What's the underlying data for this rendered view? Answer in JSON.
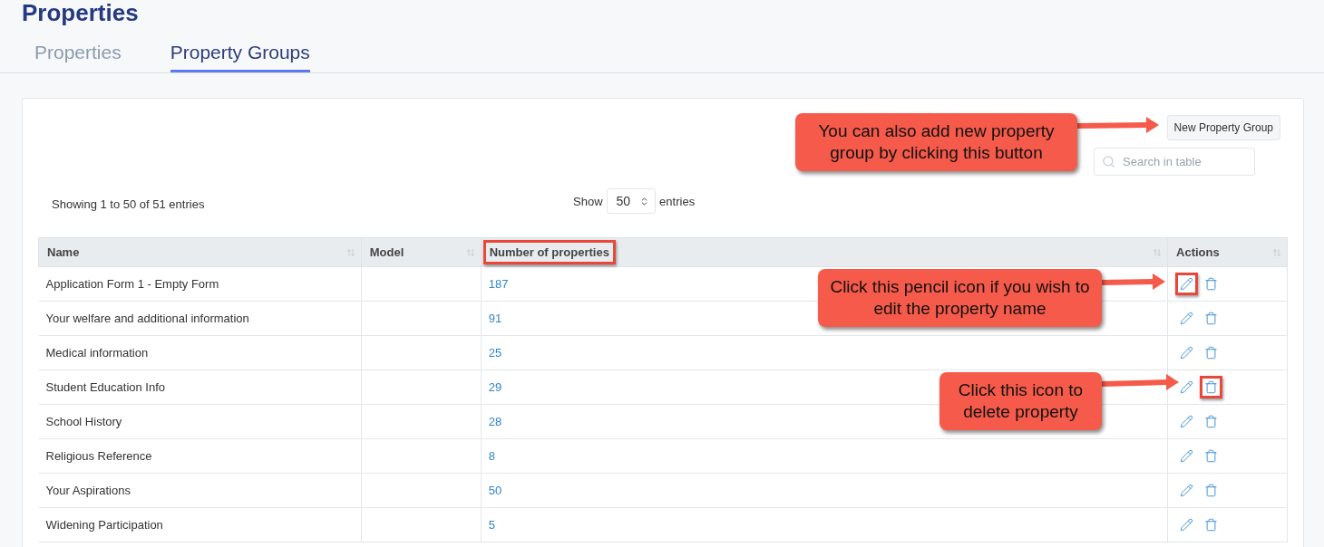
{
  "page_title": "Properties",
  "tabs": [
    {
      "label": "Properties",
      "selected": false
    },
    {
      "label": "Property Groups",
      "selected": true
    }
  ],
  "new_button": "New Property Group",
  "search": {
    "placeholder": "Search in table"
  },
  "info": "Showing 1 to 50 of 51 entries",
  "length": {
    "before": "Show",
    "value": "50",
    "after": "entries"
  },
  "columns": [
    {
      "label": "Name",
      "highlighted": false
    },
    {
      "label": "Model",
      "highlighted": false
    },
    {
      "label": "Number of properties",
      "highlighted": true
    },
    {
      "label": "Actions",
      "highlighted": false
    }
  ],
  "rows": [
    {
      "name": "Application Form 1 - Empty Form",
      "count": "187",
      "edit_highlighted": true,
      "delete_highlighted": false
    },
    {
      "name": "Your welfare and additional information",
      "count": "91",
      "edit_highlighted": false,
      "delete_highlighted": false
    },
    {
      "name": "Medical information",
      "count": "25",
      "edit_highlighted": false,
      "delete_highlighted": false
    },
    {
      "name": "Student Education Info",
      "count": "29",
      "edit_highlighted": false,
      "delete_highlighted": true
    },
    {
      "name": "School History",
      "count": "28",
      "edit_highlighted": false,
      "delete_highlighted": false
    },
    {
      "name": "Religious Reference",
      "count": "8",
      "edit_highlighted": false,
      "delete_highlighted": false
    },
    {
      "name": "Your Aspirations",
      "count": "50",
      "edit_highlighted": false,
      "delete_highlighted": false
    },
    {
      "name": "Widening Participation",
      "count": "5",
      "edit_highlighted": false,
      "delete_highlighted": false
    }
  ],
  "annotations": [
    {
      "text": "You can also add new property group by clicking this button"
    },
    {
      "text": "Click this pencil icon if you wish to edit the property name"
    },
    {
      "text": "Click this icon to delete property"
    }
  ]
}
